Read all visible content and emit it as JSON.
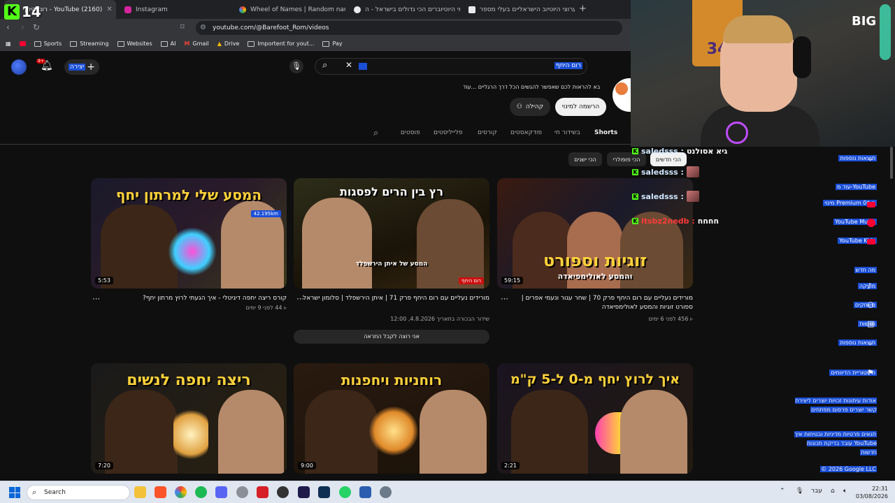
{
  "browser": {
    "tabs": [
      {
        "label": "רום היחף - YouTube (2160)",
        "favicon_color": "#ff0033"
      },
      {
        "label": "Instagram",
        "favicon_color": "#d6249f"
      },
      {
        "label": "Wheel of Names | Random name pic",
        "favicon_color": "#34a853"
      },
      {
        "label": "מי היוטיוברים הכי גדולים בישראל - ה",
        "favicon_color": "#e8eaed"
      },
      {
        "label": "ערוצי היוטיוב הישראליים בעלי מספר",
        "favicon_color": "#e8eaed"
      }
    ],
    "url": "youtube.com/@Barefoot_Rom/videos",
    "bookmarks": [
      "Sports",
      "Streaming",
      "Websites",
      "AI",
      "Gmail",
      "Drive",
      "Importent for yout...",
      "Pay"
    ]
  },
  "youtube": {
    "notification_badge": "9+",
    "create_label": "יצירה",
    "search_value": "רום היחף",
    "channel_description": "בא להראות לכם שאפשר להגשים הכל דרך הרגליים ...עוד",
    "subscribe_label": "הרשמה למינוי",
    "community_label": "קהילה",
    "channel_tabs": [
      "Shorts",
      "בשידור חי",
      "פודקאסטים",
      "קורסים",
      "פלייליסטים",
      "פוסטים"
    ],
    "filter_chips": [
      "הכי חדשים",
      "הכי פופולרי",
      "הכי ישנים"
    ],
    "notify_bar": "אני רוצה לקבל התראה",
    "videos": [
      {
        "thumb_text": "זוגיות וספורט",
        "thumb_sub": "והמסע לאולימפיאדה",
        "duration": "59:15",
        "title": "מורידים נעליים עם רום היחף פרק 70 | שחר עגור ונעמי אפרים | ספורט זוגיות והמסע לאולימפיאדה",
        "views": "456",
        "age": "לפני 6 ימים"
      },
      {
        "thumb_text": "רץ בין הרים לפסגות",
        "thumb_sub": "המסע של איתן הירשפלד",
        "duration": "",
        "title": "מורידים נעליים עם רום היחף פרק 71 | איתן הירשפלד | סלומון ישראל",
        "views": "",
        "age": "שידור הבכורה בתאריך 4.8.2026, 12:00"
      },
      {
        "thumb_text": "המסע שלי למרתון יחף",
        "thumb_sub": "42.195km",
        "duration": "5:53",
        "title": "קורס ריצה יחפה דיגיטלי - איך הגעתי לרוץ מרתון יחף?",
        "views": "44",
        "age": "לפני 9 ימים"
      },
      {
        "thumb_text": "איך לרוץ יחף מ-0 ל-5 ק\"מ",
        "duration": "2:21"
      },
      {
        "thumb_text": "רוחניות ויחפנות",
        "duration": "9:00"
      },
      {
        "thumb_text": "ריצה יחפה לנשים",
        "duration": "7:20"
      }
    ],
    "sidebar": {
      "more_results": "תוצאות נוספות",
      "premium_header": "עוד מ-YouTube",
      "premium": "מינוי Premium ב-0$",
      "music": "YouTube Music",
      "kids": "YouTube Kids",
      "whats_new": "מה חדש",
      "music_cat": "מוזיקה",
      "gaming": "משחקים",
      "news": "חדשות",
      "more_results_2": "תוצאות נוספות",
      "history": "היסטוריית הדיווחים",
      "footer_1": "אודות עיתונות זכויות יוצרים ליצירת קשר יוצרים פרסום מפתחים",
      "footer_2": "תנאים פרטיות מדיניות ובטיחות איך YouTube עובד בדיקת תכונות חדשות",
      "copyright": "© 2026 Google LLC"
    }
  },
  "stream": {
    "kick_count": "14",
    "logo_text": "BIG",
    "jersey_number": "34",
    "chat": [
      {
        "name": "גיא אסולנט",
        "msg": "saledsss :",
        "emote": false
      },
      {
        "name": "saledsss :",
        "msg": "",
        "emote": true
      },
      {
        "name": "saledsss :",
        "msg": "",
        "emote": true
      },
      {
        "name": "itsbz2nedb :",
        "msg": "חחחח",
        "emote": false
      }
    ]
  },
  "taskbar": {
    "search_label": "Search",
    "language": "עבר",
    "time": "22:31",
    "date": "03/08/2026"
  }
}
